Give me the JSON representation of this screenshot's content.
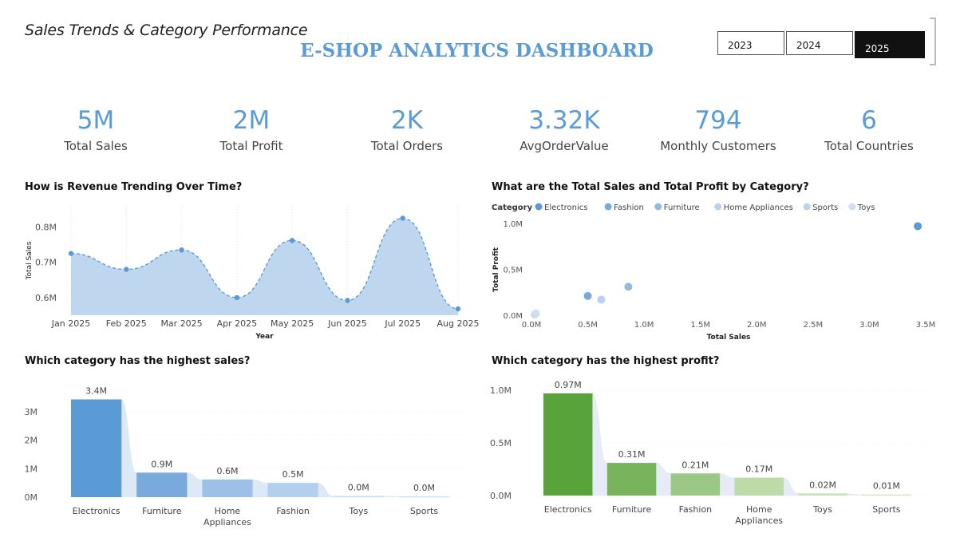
{
  "header": {
    "subtitle": "Sales Trends & Category Performance",
    "title": "E-SHOP ANALYTICS DASHBOARD"
  },
  "year_slicer": {
    "options": [
      "2023",
      "2024",
      "2025"
    ],
    "selected": "2025"
  },
  "kpis": [
    {
      "value": "5M",
      "label": "Total Sales"
    },
    {
      "value": "2M",
      "label": "Total Profit"
    },
    {
      "value": "2K",
      "label": "Total Orders"
    },
    {
      "value": "3.32K",
      "label": "AvgOrderValue"
    },
    {
      "value": "794",
      "label": "Monthly Customers"
    },
    {
      "value": "6",
      "label": "Total Countries"
    }
  ],
  "colors": {
    "accent": "#5b9bd5",
    "area_fill": "#bcd4ee",
    "profit_green": "#58a43a"
  },
  "chart_data": [
    {
      "type": "area",
      "title": "How is Revenue Trending Over Time?",
      "xlabel": "Year",
      "ylabel": "Total Sales",
      "categories": [
        "Jan 2025",
        "Feb 2025",
        "Mar 2025",
        "Apr 2025",
        "May 2025",
        "Jun 2025",
        "Jul 2025",
        "Aug 2025"
      ],
      "values": [
        725000,
        680000,
        735000,
        600000,
        762000,
        592000,
        825000,
        568000
      ],
      "ylim": [
        550000,
        860000
      ],
      "yticks": [
        {
          "value": 600000,
          "label": "0.6M"
        },
        {
          "value": 700000,
          "label": "0.7M"
        },
        {
          "value": 800000,
          "label": "0.8M"
        }
      ],
      "color": "#5b9bd5",
      "grid": "vertical dotted"
    },
    {
      "type": "scatter",
      "title": "What are the Total Sales and Total Profit by Category?",
      "xlabel": "Total Sales",
      "ylabel": "Total Profit",
      "legend_title": "Category",
      "legend_position": "top-left",
      "series": [
        {
          "name": "Electronics",
          "x": 3430000,
          "y": 970000,
          "color": "#5b9bd5"
        },
        {
          "name": "Fashion",
          "x": 500000,
          "y": 210000,
          "color": "#7aa9dc"
        },
        {
          "name": "Furniture",
          "x": 860000,
          "y": 310000,
          "color": "#96badf"
        },
        {
          "name": "Home Appliances",
          "x": 620000,
          "y": 170000,
          "color": "#b9d1ec"
        },
        {
          "name": "Sports",
          "x": 30000,
          "y": 10000,
          "color": "#b9d5e6"
        },
        {
          "name": "Toys",
          "x": 40000,
          "y": 20000,
          "color": "#cfdff2"
        }
      ],
      "xlim": [
        0,
        3500000
      ],
      "ylim": [
        0,
        1000000
      ],
      "xticks": [
        {
          "value": 0,
          "label": "0.0M"
        },
        {
          "value": 500000,
          "label": "0.5M"
        },
        {
          "value": 1000000,
          "label": "1.0M"
        },
        {
          "value": 1500000,
          "label": "1.5M"
        },
        {
          "value": 2000000,
          "label": "2.0M"
        },
        {
          "value": 2500000,
          "label": "2.5M"
        },
        {
          "value": 3000000,
          "label": "3.0M"
        },
        {
          "value": 3500000,
          "label": "3.5M"
        }
      ],
      "yticks": [
        {
          "value": 0,
          "label": "0.0M"
        },
        {
          "value": 500000,
          "label": "0.5M"
        },
        {
          "value": 1000000,
          "label": "1.0M"
        }
      ]
    },
    {
      "type": "bar",
      "title": "Which category has the highest sales?",
      "categories": [
        "Electronics",
        "Furniture",
        "Home Appliances",
        "Fashion",
        "Toys",
        "Sports"
      ],
      "values": [
        3430000,
        860000,
        620000,
        500000,
        40000,
        30000
      ],
      "data_labels": [
        "3.4M",
        "0.9M",
        "0.6M",
        "0.5M",
        "0.0M",
        "0.0M"
      ],
      "colors": [
        "#5b9bd5",
        "#7aa9dc",
        "#9dc1e6",
        "#b2cfee",
        "#c2daf2",
        "#cfe1f4"
      ],
      "ylim": [
        0,
        3500000
      ],
      "yticks": [
        {
          "value": 0,
          "label": "0M"
        },
        {
          "value": 1000000,
          "label": "1M"
        },
        {
          "value": 2000000,
          "label": "2M"
        },
        {
          "value": 3000000,
          "label": "3M"
        }
      ]
    },
    {
      "type": "bar",
      "title": "Which category has the highest profit?",
      "categories": [
        "Electronics",
        "Furniture",
        "Fashion",
        "Home Appliances",
        "Toys",
        "Sports"
      ],
      "values": [
        970000,
        310000,
        210000,
        170000,
        20000,
        10000
      ],
      "data_labels": [
        "0.97M",
        "0.31M",
        "0.21M",
        "0.17M",
        "0.02M",
        "0.01M"
      ],
      "colors": [
        "#58a43a",
        "#78b45c",
        "#9bc985",
        "#bddaa9",
        "#c8e2b6",
        "#d3e8c5"
      ],
      "ylim": [
        0,
        1000000
      ],
      "yticks": [
        {
          "value": 0,
          "label": "0.0M"
        },
        {
          "value": 500000,
          "label": "0.5M"
        },
        {
          "value": 1000000,
          "label": "1.0M"
        }
      ]
    }
  ]
}
